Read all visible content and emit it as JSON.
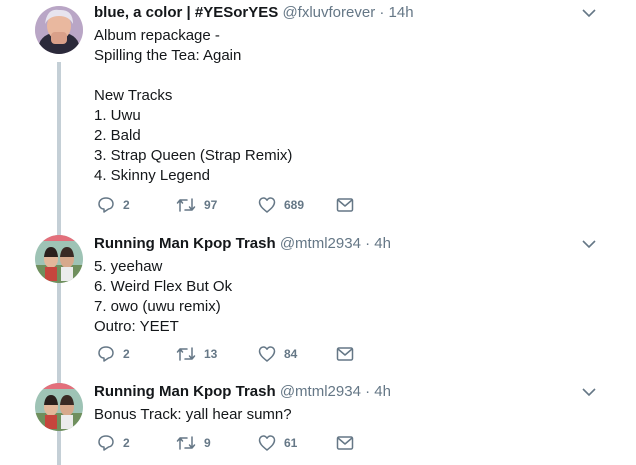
{
  "tweets": [
    {
      "name": "blue, a color | #YESorYES",
      "handle": "@fxluvforever",
      "sep": "·",
      "time": "14h",
      "lines": [
        "Album repackage -",
        "Spilling the Tea: Again",
        "",
        "New Tracks",
        "1. Uwu",
        "2. Bald",
        "3. Strap Queen (Strap Remix)",
        "4. Skinny Legend"
      ],
      "replies": "2",
      "retweets": "97",
      "likes": "689"
    },
    {
      "name": "Running Man Kpop Trash",
      "handle": "@mtml2934",
      "sep": "·",
      "time": "4h",
      "lines": [
        "5. yeehaw",
        "6. Weird Flex But Ok",
        "7. owo (uwu remix)",
        "Outro: YEET"
      ],
      "replies": "2",
      "retweets": "13",
      "likes": "84"
    },
    {
      "name": "Running Man Kpop Trash",
      "handle": "@mtml2934",
      "sep": "·",
      "time": "4h",
      "lines": [
        "Bonus Track: yall hear sumn?"
      ],
      "replies": "2",
      "retweets": "9",
      "likes": "61"
    }
  ],
  "icons": {
    "reply": "reply-icon",
    "retweet": "retweet-icon",
    "like": "heart-icon",
    "dm": "envelope-icon",
    "more": "chevron-down-icon"
  },
  "colors": {
    "name": "#14171a",
    "meta": "#657786",
    "thread_line": "#c4cfd6",
    "icon": "#657786"
  }
}
